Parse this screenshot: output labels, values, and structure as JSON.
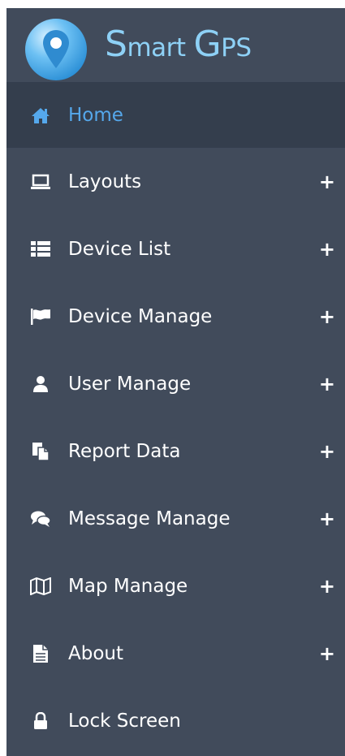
{
  "logo": {
    "part1_cap": "S",
    "part1_rest": "mart",
    "part2_cap": "G",
    "part2_rest": "PS",
    "icon": "map-pin-icon"
  },
  "colors": {
    "sidebar_bg": "#414b5b",
    "active_bg": "#343e4d",
    "active_text": "#55a8ec",
    "logo_text": "#8ed1f6"
  },
  "menu": {
    "expand_symbol": "+",
    "items": [
      {
        "label": "Home",
        "icon": "home-icon",
        "active": true
      },
      {
        "label": "Layouts",
        "icon": "laptop-icon",
        "expandable": true
      },
      {
        "label": "Device List",
        "icon": "list-icon",
        "expandable": true
      },
      {
        "label": "Device Manage",
        "icon": "flag-icon",
        "expandable": true
      },
      {
        "label": "User Manage",
        "icon": "user-icon",
        "expandable": true
      },
      {
        "label": "Report Data",
        "icon": "copy-icon",
        "expandable": true
      },
      {
        "label": "Message Manage",
        "icon": "comments-icon",
        "expandable": true
      },
      {
        "label": "Map Manage",
        "icon": "map-icon",
        "expandable": true
      },
      {
        "label": "About",
        "icon": "file-icon",
        "expandable": true
      },
      {
        "label": "Lock Screen",
        "icon": "lock-icon"
      }
    ]
  }
}
